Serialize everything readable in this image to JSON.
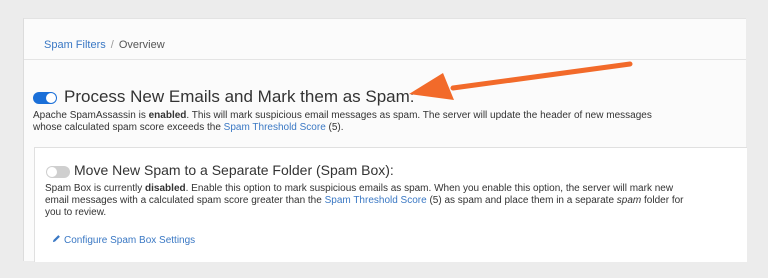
{
  "breadcrumb": {
    "parent": "Spam Filters",
    "separator": "/",
    "current": "Overview"
  },
  "process": {
    "enabled": true,
    "title": "Process New Emails and Mark them as Spam:",
    "desc_prefix": "Apache SpamAssassin is ",
    "desc_state": "enabled",
    "desc_mid": ". This will mark suspicious email messages as spam. The server will update the header of new messages whose calculated spam score exceeds the ",
    "desc_link": "Spam Threshold Score",
    "desc_suffix": " (5)."
  },
  "spam_box": {
    "enabled": false,
    "title": "Move New Spam to a Separate Folder (Spam Box):",
    "desc_prefix": "Spam Box is currently ",
    "desc_state": "disabled",
    "desc_mid": ". Enable this option to mark suspicious emails as spam. When you enable this option, the server will mark new email messages with a calculated spam score greater than the ",
    "desc_link": "Spam Threshold Score",
    "desc_mid2": " (5) as spam and place them in a separate ",
    "desc_italic": "spam",
    "desc_suffix": " folder for you to review.",
    "configure_label": "Configure Spam Box Settings"
  },
  "colors": {
    "accent": "#1a6fd8",
    "link": "#3a78c4",
    "arrow": "#f26a2a",
    "toggle_off": "#cfcfcf"
  },
  "icons": {
    "pencil": "pencil-icon",
    "arrow": "annotation-arrow"
  }
}
